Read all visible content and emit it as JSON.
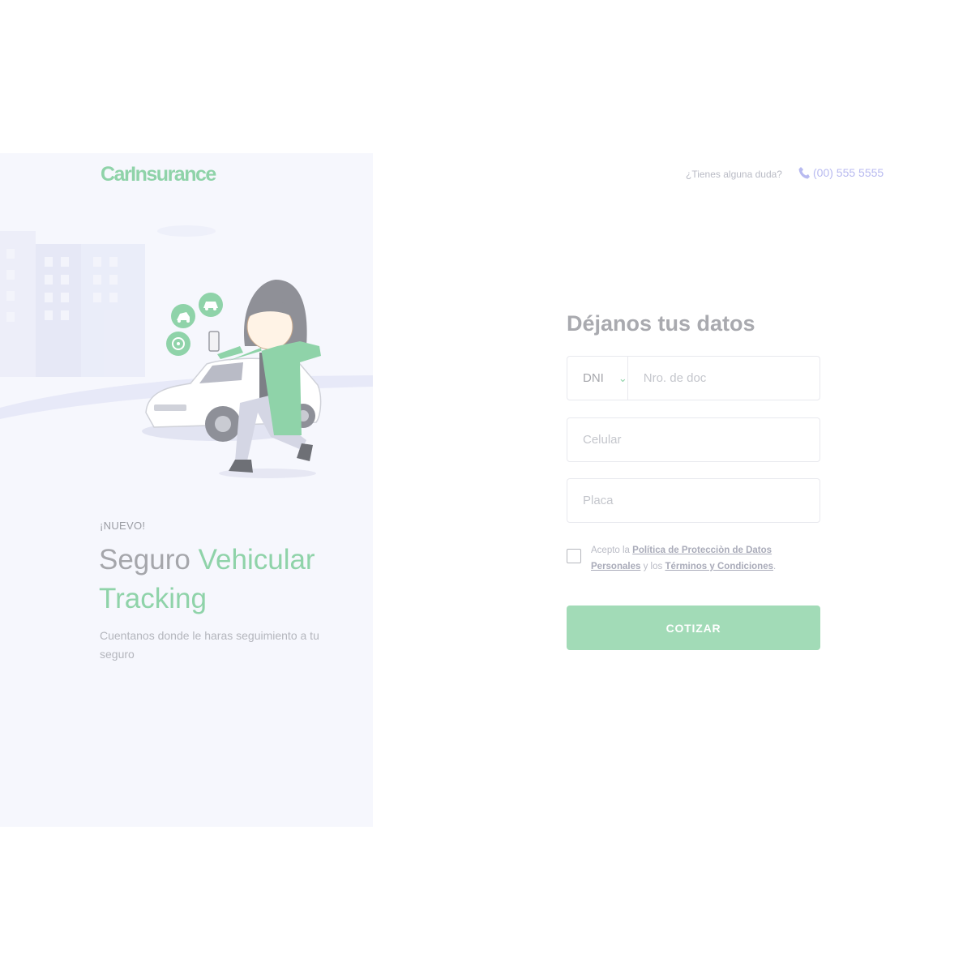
{
  "header": {
    "logo_text": "CarInsurance",
    "help_text": "¿Tienes alguna duda?",
    "phone": "(00) 555 5555"
  },
  "hero": {
    "badge": "¡NUEVO!",
    "title_part1": "Seguro",
    "title_part2": "Vehicular Tracking",
    "subtitle": "Cuentanos donde le haras seguimiento a tu seguro",
    "illustration_icons": [
      "car-icon",
      "tow-truck-icon",
      "steering-wheel-icon",
      "phone-icon"
    ]
  },
  "form": {
    "title": "Déjanos tus datos",
    "doc_type": "DNI",
    "doc_placeholder": "Nro. de doc",
    "phone_placeholder": "Celular",
    "plate_placeholder": "Placa",
    "consent_prefix": "Acepto la",
    "privacy_link": "Política de Protecciòn de Datos Personales",
    "consent_middle": "y los",
    "terms_link": "Términos y Condiciones",
    "consent_suffix": ".",
    "submit_label": "COTIZAR",
    "consent_checked": false
  },
  "colors": {
    "accent": "#8fd3a9",
    "button": "#a2dbb7",
    "panel_bg": "#f6f7fd",
    "phone": "#b8baf0"
  }
}
